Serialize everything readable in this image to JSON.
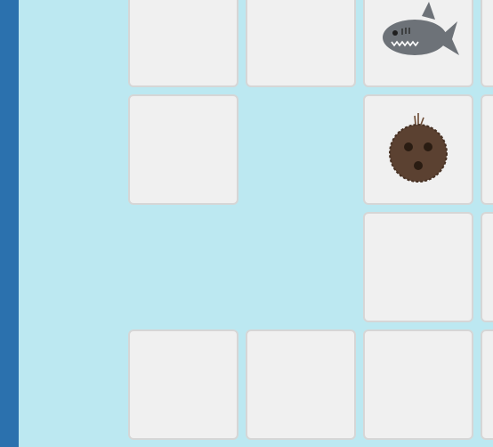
{
  "board": {
    "background": "#bce8f1",
    "sidebar_color": "#2b71ae",
    "tile_color": "#f0f0f0",
    "tile_border_color": "#d6d6d6",
    "tiles": [
      {
        "row": 0,
        "col": 0,
        "content": "empty"
      },
      {
        "row": 0,
        "col": 1,
        "content": "empty"
      },
      {
        "row": 0,
        "col": 2,
        "content": "shark-icon"
      },
      {
        "row": 0,
        "col": 3,
        "content": "empty"
      },
      {
        "row": 1,
        "col": 0,
        "content": "empty"
      },
      {
        "row": 1,
        "col": 2,
        "content": "coconut-icon"
      },
      {
        "row": 1,
        "col": 3,
        "content": "empty"
      },
      {
        "row": 2,
        "col": 2,
        "content": "empty"
      },
      {
        "row": 2,
        "col": 3,
        "content": "empty"
      },
      {
        "row": 3,
        "col": 0,
        "content": "empty"
      },
      {
        "row": 3,
        "col": 1,
        "content": "empty"
      },
      {
        "row": 3,
        "col": 2,
        "content": "empty"
      },
      {
        "row": 3,
        "col": 3,
        "content": "empty"
      }
    ]
  },
  "icons": {
    "shark": {
      "name": "shark-icon",
      "body_color": "#6d7278",
      "teeth_color": "#ffffff"
    },
    "coconut": {
      "name": "coconut-icon",
      "shell_color": "#5b4131",
      "eye_color": "#2a1c12"
    }
  }
}
